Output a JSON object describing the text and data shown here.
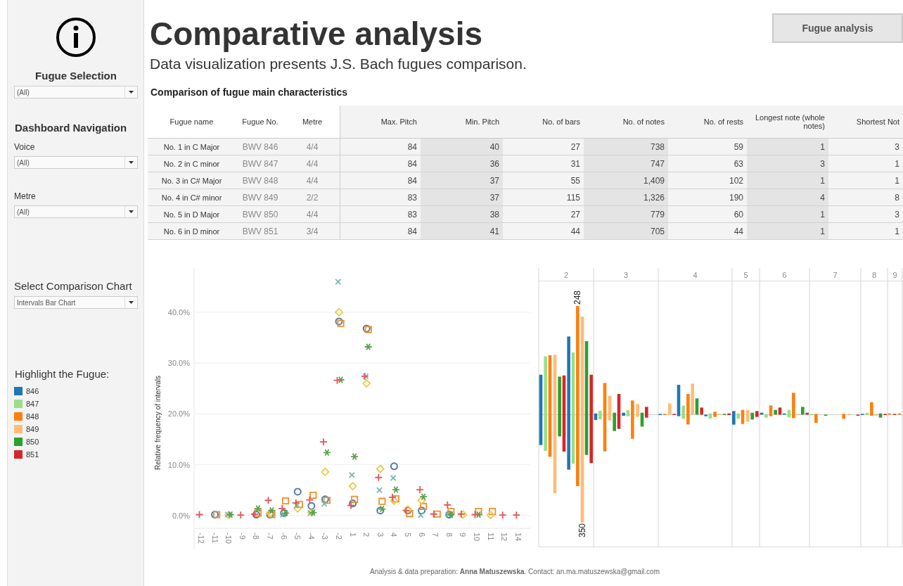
{
  "sidebar": {
    "fugue_selection": {
      "label": "Fugue Selection",
      "value": "(All)"
    },
    "navigation_title": "Dashboard Navigation",
    "filters": [
      {
        "label": "Voice",
        "value": "(All)"
      },
      {
        "label": "Metre",
        "value": "(All)"
      }
    ],
    "chart_select": {
      "label": "Select Comparison Chart",
      "value": "Intervals Bar Chart"
    },
    "legend": {
      "title": "Highlight the Fugue:",
      "items": [
        {
          "label": "846",
          "color": "#1f77b4"
        },
        {
          "label": "847",
          "color": "#98df8a"
        },
        {
          "label": "848",
          "color": "#ff7f0e"
        },
        {
          "label": "849",
          "color": "#ffbb78"
        },
        {
          "label": "850",
          "color": "#2ca02c"
        },
        {
          "label": "851",
          "color": "#d62728"
        }
      ]
    }
  },
  "header": {
    "title": "Comparative analysis",
    "subtitle": "Data visualization presents J.S. Bach fugues comparison.",
    "button": "Fugue analysis"
  },
  "table": {
    "title": "Comparison of fugue main characteristics",
    "columns": [
      "Fugue name",
      "Fugue No.",
      "Metre",
      "Max. Pitch",
      "Min. Pitch",
      "No. of bars",
      "No. of notes",
      "No. of rests",
      "Longest note (whole notes)",
      "Shortest Not"
    ],
    "rows": [
      [
        "No. 1 in C Major",
        "BWV 846",
        "4/4",
        "84",
        "40",
        "27",
        "738",
        "59",
        "1",
        "3"
      ],
      [
        "No. 2 in C minor",
        "BWV 847",
        "4/4",
        "84",
        "36",
        "31",
        "747",
        "63",
        "3",
        "1"
      ],
      [
        "No. 3 in C# Major",
        "BWV 848",
        "4/4",
        "84",
        "37",
        "55",
        "1,409",
        "102",
        "1",
        "1"
      ],
      [
        "No. 4 in C# minor",
        "BWV 849",
        "2/2",
        "83",
        "37",
        "115",
        "1,326",
        "190",
        "4",
        "8"
      ],
      [
        "No. 5 in D Major",
        "BWV 850",
        "4/4",
        "83",
        "38",
        "27",
        "779",
        "60",
        "1",
        "3"
      ],
      [
        "No. 6 in D minor",
        "BWV 851",
        "3/4",
        "84",
        "41",
        "44",
        "705",
        "44",
        "1",
        "1"
      ]
    ]
  },
  "scatter": {
    "chart_data": {
      "type": "scatter",
      "ylabel": "Relative frequency of intervals",
      "ylim": [
        -2.5,
        48.7
      ],
      "grid": true,
      "categories": [
        "-12",
        "-11",
        "-10",
        "-9",
        "-8",
        "-7",
        "-6",
        "-5",
        "-4",
        "-3",
        "-2",
        "1",
        "2",
        "3",
        "4",
        "5",
        "6",
        "7",
        "8",
        "9",
        "10",
        "11",
        "12",
        "14"
      ],
      "yticks": [
        {
          "value": 0,
          "label": "0.0%"
        },
        {
          "value": 10,
          "label": "10.0%"
        },
        {
          "value": 20,
          "label": "20.0%"
        },
        {
          "value": 30,
          "label": "30.0%"
        },
        {
          "value": 40,
          "label": "40.0%"
        }
      ],
      "series": [
        {
          "marker": "circle",
          "color": "#4e79a7",
          "values": [
            null,
            0.2,
            null,
            null,
            0.2,
            0.2,
            0.5,
            4.7,
            1.9,
            3.2,
            38.2,
            2.4,
            36.8,
            1.0,
            9.7,
            1.0,
            1.0,
            null,
            0.2,
            null,
            null,
            null,
            null,
            null
          ]
        },
        {
          "marker": "square",
          "color": "#f28e2b",
          "values": [
            null,
            0.2,
            null,
            null,
            0.5,
            0.2,
            2.9,
            2.2,
            4.0,
            3.0,
            37.8,
            3.2,
            36.6,
            2.8,
            3.3,
            0.4,
            1.8,
            0.3,
            0.8,
            null,
            0.8,
            0.8,
            null,
            null
          ]
        },
        {
          "marker": "diamond",
          "color": "#edc948",
          "values": [
            null,
            null,
            0.1,
            null,
            null,
            0.5,
            null,
            1.4,
            0.6,
            8.6,
            40.0,
            5.8,
            26.0,
            9.2,
            2.9,
            1.2,
            3.0,
            null,
            null,
            0.2,
            null,
            0.1,
            null,
            null
          ]
        },
        {
          "marker": "cross",
          "color": "#76b7b2",
          "values": [
            null,
            null,
            0.2,
            null,
            null,
            null,
            0.2,
            2.0,
            0.5,
            2.3,
            46.0,
            8.0,
            27.4,
            5.0,
            7.4,
            null,
            0.1,
            null,
            0.2,
            null,
            null,
            null,
            null,
            null
          ]
        },
        {
          "color": "#59a14f",
          "values": [
            null,
            null,
            0.2,
            null,
            1.4,
            1.0,
            0.5,
            null,
            0.6,
            12.4,
            26.7,
            11.6,
            33.2,
            1.3,
            5.1,
            null,
            3.7,
            null,
            0.2,
            null,
            0.2,
            null,
            null,
            null
          ]
        },
        {
          "marker": "plus",
          "color": "#e15759",
          "values": [
            0.2,
            null,
            null,
            0.1,
            0.3,
            3.0,
            1.4,
            2.5,
            3.1,
            14.5,
            26.6,
            2.0,
            27.4,
            7.5,
            3.6,
            1.0,
            5.1,
            0.3,
            2.1,
            0.3,
            0.2,
            null,
            0.1,
            0.1
          ]
        }
      ]
    }
  },
  "bar_chart": {
    "columns": [
      "2",
      "3",
      "4",
      "5",
      "6",
      "7",
      "8",
      "9"
    ],
    "value_labels": [
      "248",
      "350"
    ]
  },
  "footer": "Analysis & data preparation: **Anna Matuszewska**. Contact: an.ma.matuszewska@gmail.com"
}
